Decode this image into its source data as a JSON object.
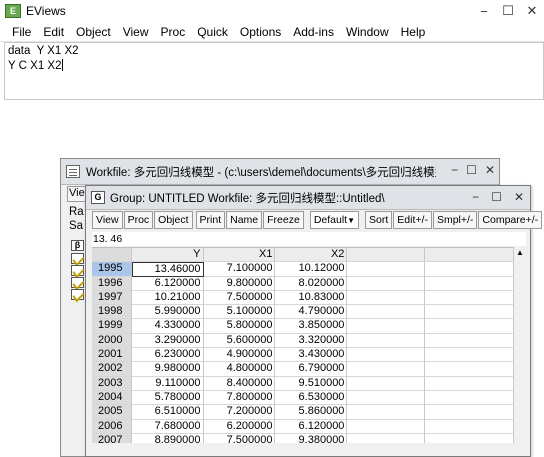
{
  "app": {
    "title": "EViews",
    "icon_label": "E"
  },
  "window_controls": {
    "minimize": "−",
    "maximize": "☐",
    "close": "✕"
  },
  "menu": [
    "File",
    "Edit",
    "Object",
    "View",
    "Proc",
    "Quick",
    "Options",
    "Add-ins",
    "Window",
    "Help"
  ],
  "command": {
    "line1": "data  Y X1 X2",
    "line2": "Y C X1 X2"
  },
  "workfile_window": {
    "title": "Workfile: 多元回归线模型 - (c:\\users\\demel\\documents\\多元回归线模型.wf...",
    "view_btn": "Vie",
    "labels": [
      "Ra",
      "Sa"
    ],
    "object_icons": [
      "coef-icon",
      "series-icon",
      "series-icon",
      "series-icon",
      "series-icon"
    ],
    "coef_glyph": "β"
  },
  "group_window": {
    "icon_label": "G",
    "title": "Group: UNTITLED   Workfile: 多元回归线模型::Untitled\\",
    "toolbar": [
      "View",
      "Proc",
      "Object",
      "Print",
      "Name",
      "Freeze"
    ],
    "toolbar_right": [
      "Sort",
      "Edit+/-",
      "Smpl+/-",
      "Compare+/-"
    ],
    "sample_select": "Default",
    "edit_value": "13. 46",
    "columns": [
      "Y",
      "X1",
      "X2"
    ],
    "rows": [
      {
        "obs": "1995",
        "y": "13.46000",
        "x1": "7.100000",
        "x2": "10.12000"
      },
      {
        "obs": "1996",
        "y": "6.120000",
        "x1": "9.800000",
        "x2": "8.020000"
      },
      {
        "obs": "1997",
        "y": "10.21000",
        "x1": "7.500000",
        "x2": "10.83000"
      },
      {
        "obs": "1998",
        "y": "5.990000",
        "x1": "5.100000",
        "x2": "4.790000"
      },
      {
        "obs": "1999",
        "y": "4.330000",
        "x1": "5.800000",
        "x2": "3.850000"
      },
      {
        "obs": "2000",
        "y": "3.290000",
        "x1": "5.600000",
        "x2": "3.320000"
      },
      {
        "obs": "2001",
        "y": "6.230000",
        "x1": "4.900000",
        "x2": "3.430000"
      },
      {
        "obs": "2002",
        "y": "9.980000",
        "x1": "4.800000",
        "x2": "6.790000"
      },
      {
        "obs": "2003",
        "y": "9.110000",
        "x1": "8.400000",
        "x2": "9.510000"
      },
      {
        "obs": "2004",
        "y": "5.780000",
        "x1": "7.800000",
        "x2": "6.530000"
      },
      {
        "obs": "2005",
        "y": "6.510000",
        "x1": "7.200000",
        "x2": "5.860000"
      },
      {
        "obs": "2006",
        "y": "7.680000",
        "x1": "6.200000",
        "x2": "6.120000"
      },
      {
        "obs": "2007",
        "y": "8.890000",
        "x1": "7.500000",
        "x2": "9.380000"
      }
    ],
    "scroll_up": "▲"
  }
}
